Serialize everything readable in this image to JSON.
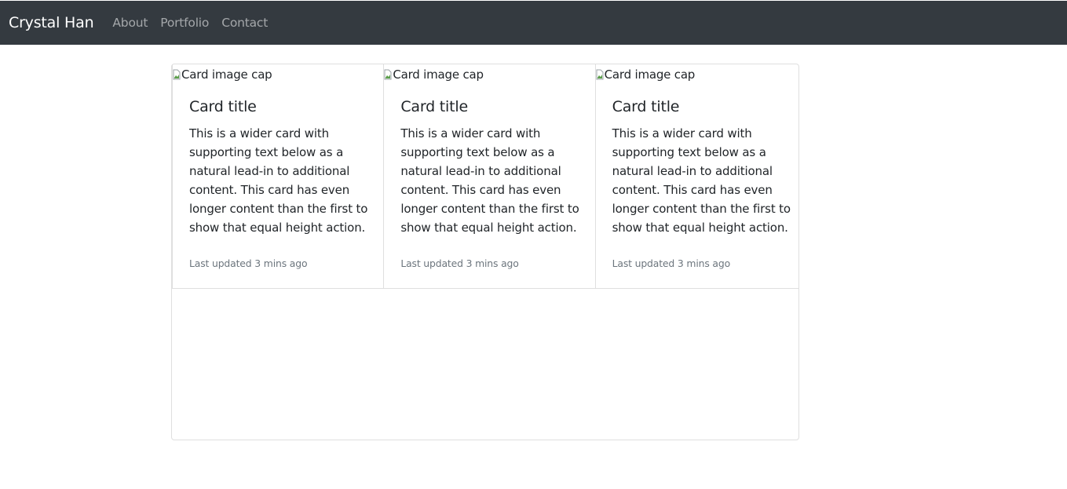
{
  "navbar": {
    "brand": "Crystal Han",
    "links": [
      "About",
      "Portfolio",
      "Contact"
    ]
  },
  "cards": [
    {
      "image_alt": "Card image cap",
      "title": "Card title",
      "text_lines": [
        "This is a wider card with",
        "supporting text below as a",
        "natural lead-in to additional",
        "content. This card has even",
        "longer content than the first to",
        "show that equal height action."
      ],
      "updated": "Last updated 3 mins ago"
    },
    {
      "image_alt": "Card image cap",
      "title": "Card title",
      "text_lines": [
        "This is a wider card with",
        "supporting text below as a",
        "natural lead-in to additional",
        "content. This card has even",
        "longer content than the first to",
        "show that equal height action."
      ],
      "updated": "Last updated 3 mins ago"
    },
    {
      "image_alt": "Card image cap",
      "title": "Card title",
      "text_lines": [
        "This is a wider card with",
        "supporting text below as a",
        "natural lead-in to additional",
        "content. This card has even",
        "longer content than the first to",
        "show that equal height action."
      ],
      "updated": "Last updated 3 mins ago"
    }
  ],
  "colors": {
    "navbar_bg": "#343a40",
    "brand_text": "#ffffff",
    "nav_link_text": "#9a9da0",
    "muted_text": "#6c757d",
    "card_border": "#dfdfdf"
  }
}
